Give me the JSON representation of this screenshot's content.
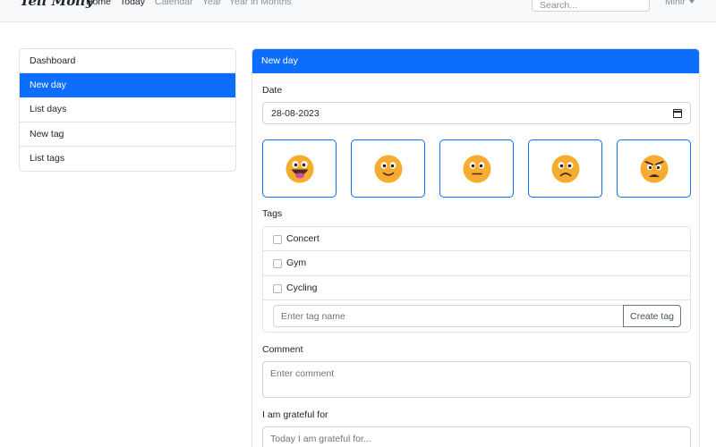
{
  "navbar": {
    "brand": "Tell Molly",
    "links": [
      {
        "label": "Home",
        "active": true
      },
      {
        "label": "Today",
        "active": true
      },
      {
        "label": "Calendar",
        "active": false
      },
      {
        "label": "Year",
        "active": false
      },
      {
        "label": "Year in Months",
        "active": false
      }
    ],
    "search_placeholder": "Search...",
    "user": "Mihir"
  },
  "sidebar": {
    "items": [
      {
        "label": "Dashboard",
        "active": false
      },
      {
        "label": "New day",
        "active": true
      },
      {
        "label": "List days",
        "active": false
      },
      {
        "label": "New tag",
        "active": false
      },
      {
        "label": "List tags",
        "active": false
      }
    ]
  },
  "form": {
    "header": "New day",
    "date_label": "Date",
    "date_value": "28-08-2023",
    "moods": [
      {
        "icon": "grinning-tongue-face-icon"
      },
      {
        "icon": "smiling-face-icon"
      },
      {
        "icon": "neutral-face-icon"
      },
      {
        "icon": "frowning-face-icon"
      },
      {
        "icon": "angry-face-icon"
      }
    ],
    "tags_label": "Tags",
    "tags": [
      "Concert",
      "Gym",
      "Cycling"
    ],
    "tag_input_placeholder": "Enter tag name",
    "create_tag_label": "Create tag",
    "comment_label": "Comment",
    "comment_placeholder": "Enter comment",
    "grateful_label": "I am grateful for",
    "grateful_placeholder": "Today I am grateful for..."
  },
  "colors": {
    "primary": "#0d6efd",
    "emoji_fill": "#f6ac2f"
  }
}
